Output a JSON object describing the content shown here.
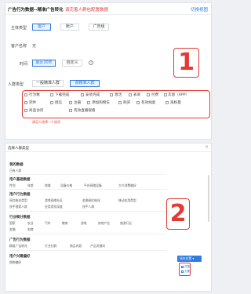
{
  "panel1": {
    "title": "广告行为数据--精准广告转化",
    "warning": "请完善人群包配置数据",
    "switch_label": "切换视图",
    "subject_type": {
      "label": "主体类型",
      "options": [
        "客户",
        "账户",
        "广告组"
      ]
    },
    "customer_name": {
      "label": "客户名称",
      "value": "无"
    },
    "time": {
      "label": "时间",
      "options": [
        "最近30天",
        "自定义"
      ]
    },
    "crowd_type": {
      "label": "人群类型",
      "options": [
        "一般精准人群",
        "高精准人群"
      ]
    },
    "behaviors": [
      [
        "行为数",
        "下载完成",
        "安装完成",
        "激活",
        "表单",
        "付费",
        "次留（APP）"
      ],
      [
        "完件",
        "授信",
        "注册",
        "添加购物车",
        "购买",
        "有效线索",
        "涨粉量"
      ],
      [
        "商品访问",
        "有效直播观看"
      ]
    ],
    "hint": "请至少选择一个选项",
    "badge": "1"
  },
  "panel2": {
    "title": "选择人群类型",
    "close": "×",
    "sections": [
      {
        "title": "我的数据",
        "items": [
          "已有人群"
        ]
      },
      {
        "title": "用户基础数据",
        "items": [
          "性别",
          "年龄",
          "地域",
          "设备价格",
          "平台网络设备",
          "大众消费偏好"
        ]
      },
      {
        "title": "用户行为数据",
        "items": [
          "网红粉丝类型",
          "游戏网络社区",
          "金融网红粉丝",
          "移动应用类型",
          "快手搜索人群",
          "应用类别深度",
          "快手人群"
        ]
      },
      {
        "title": "行业细分数据",
        "items": [
          "国家",
          "农业",
          "汽车",
          "教育",
          "游戏",
          "房地产业",
          "旅游行业"
        ]
      },
      {
        "title": "",
        "items": [
          "金融",
          "电商"
        ]
      },
      {
        "title": "广告行为数据",
        "items": [
          "精准广告转化",
          "行业社群",
          "商品内容",
          "产品关键词"
        ]
      },
      {
        "title": "用户兴趣偏好",
        "items": [
          "购物偏好"
        ]
      }
    ],
    "side_button": "所在位置 ▾",
    "side_options": [
      "并集",
      "交集"
    ],
    "badge": "2"
  }
}
